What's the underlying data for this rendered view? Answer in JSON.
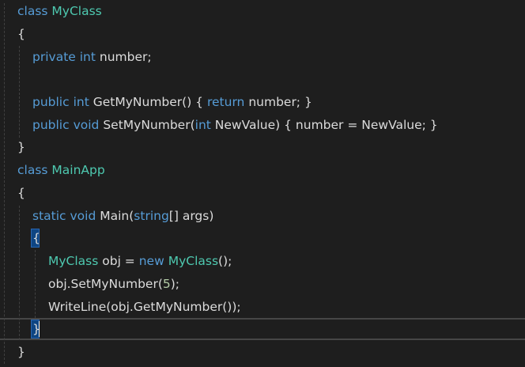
{
  "editor": {
    "lines": [
      {
        "id": "l1",
        "tokens": [
          [
            "kw",
            "class"
          ],
          [
            "pl",
            " "
          ],
          [
            "ty",
            "MyClass"
          ]
        ]
      },
      {
        "id": "l2",
        "tokens": [
          [
            "pl",
            "{"
          ]
        ]
      },
      {
        "id": "l3",
        "tokens": [
          [
            "kw",
            "private"
          ],
          [
            "pl",
            " "
          ],
          [
            "kw",
            "int"
          ],
          [
            "pl",
            " number;"
          ]
        ]
      },
      {
        "id": "l4",
        "tokens": []
      },
      {
        "id": "l5",
        "tokens": [
          [
            "kw",
            "public"
          ],
          [
            "pl",
            " "
          ],
          [
            "kw",
            "int"
          ],
          [
            "pl",
            " GetMyNumber() { "
          ],
          [
            "kw",
            "return"
          ],
          [
            "pl",
            " number; }"
          ]
        ]
      },
      {
        "id": "l6",
        "tokens": [
          [
            "kw",
            "public"
          ],
          [
            "pl",
            " "
          ],
          [
            "kw",
            "void"
          ],
          [
            "pl",
            " SetMyNumber("
          ],
          [
            "kw",
            "int"
          ],
          [
            "pl",
            " NewValue) { number = NewValue; }"
          ]
        ]
      },
      {
        "id": "l7",
        "tokens": [
          [
            "pl",
            "}"
          ]
        ]
      },
      {
        "id": "l8",
        "tokens": [
          [
            "kw",
            "class"
          ],
          [
            "pl",
            " "
          ],
          [
            "ty",
            "MainApp"
          ]
        ]
      },
      {
        "id": "l9",
        "tokens": [
          [
            "pl",
            "{"
          ]
        ]
      },
      {
        "id": "l10",
        "tokens": [
          [
            "kw",
            "static"
          ],
          [
            "pl",
            " "
          ],
          [
            "kw",
            "void"
          ],
          [
            "pl",
            " Main("
          ],
          [
            "kw",
            "string"
          ],
          [
            "pl",
            "[] args)"
          ]
        ]
      },
      {
        "id": "l11",
        "tokens": [
          [
            "pl",
            "{"
          ]
        ]
      },
      {
        "id": "l12",
        "tokens": [
          [
            "ty",
            "MyClass"
          ],
          [
            "pl",
            " obj = "
          ],
          [
            "kw",
            "new"
          ],
          [
            "pl",
            " "
          ],
          [
            "ty",
            "MyClass"
          ],
          [
            "pl",
            "();"
          ]
        ]
      },
      {
        "id": "l13",
        "tokens": [
          [
            "pl",
            "obj.SetMyNumber("
          ],
          [
            "nu",
            "5"
          ],
          [
            "pl",
            ");"
          ]
        ]
      },
      {
        "id": "l14",
        "tokens": [
          [
            "pl",
            "WriteLine(obj.GetMyNumber());"
          ]
        ]
      },
      {
        "id": "l15",
        "tokens": [
          [
            "pl",
            "}"
          ]
        ]
      },
      {
        "id": "l16",
        "tokens": [
          [
            "pl",
            "}"
          ]
        ]
      }
    ]
  },
  "colors": {
    "background": "#1e1e1e",
    "keyword": "#569cd6",
    "type": "#4ec9b0",
    "plain": "#dcdcdc",
    "number": "#b5cea8",
    "brace_highlight": "#0e4583"
  }
}
